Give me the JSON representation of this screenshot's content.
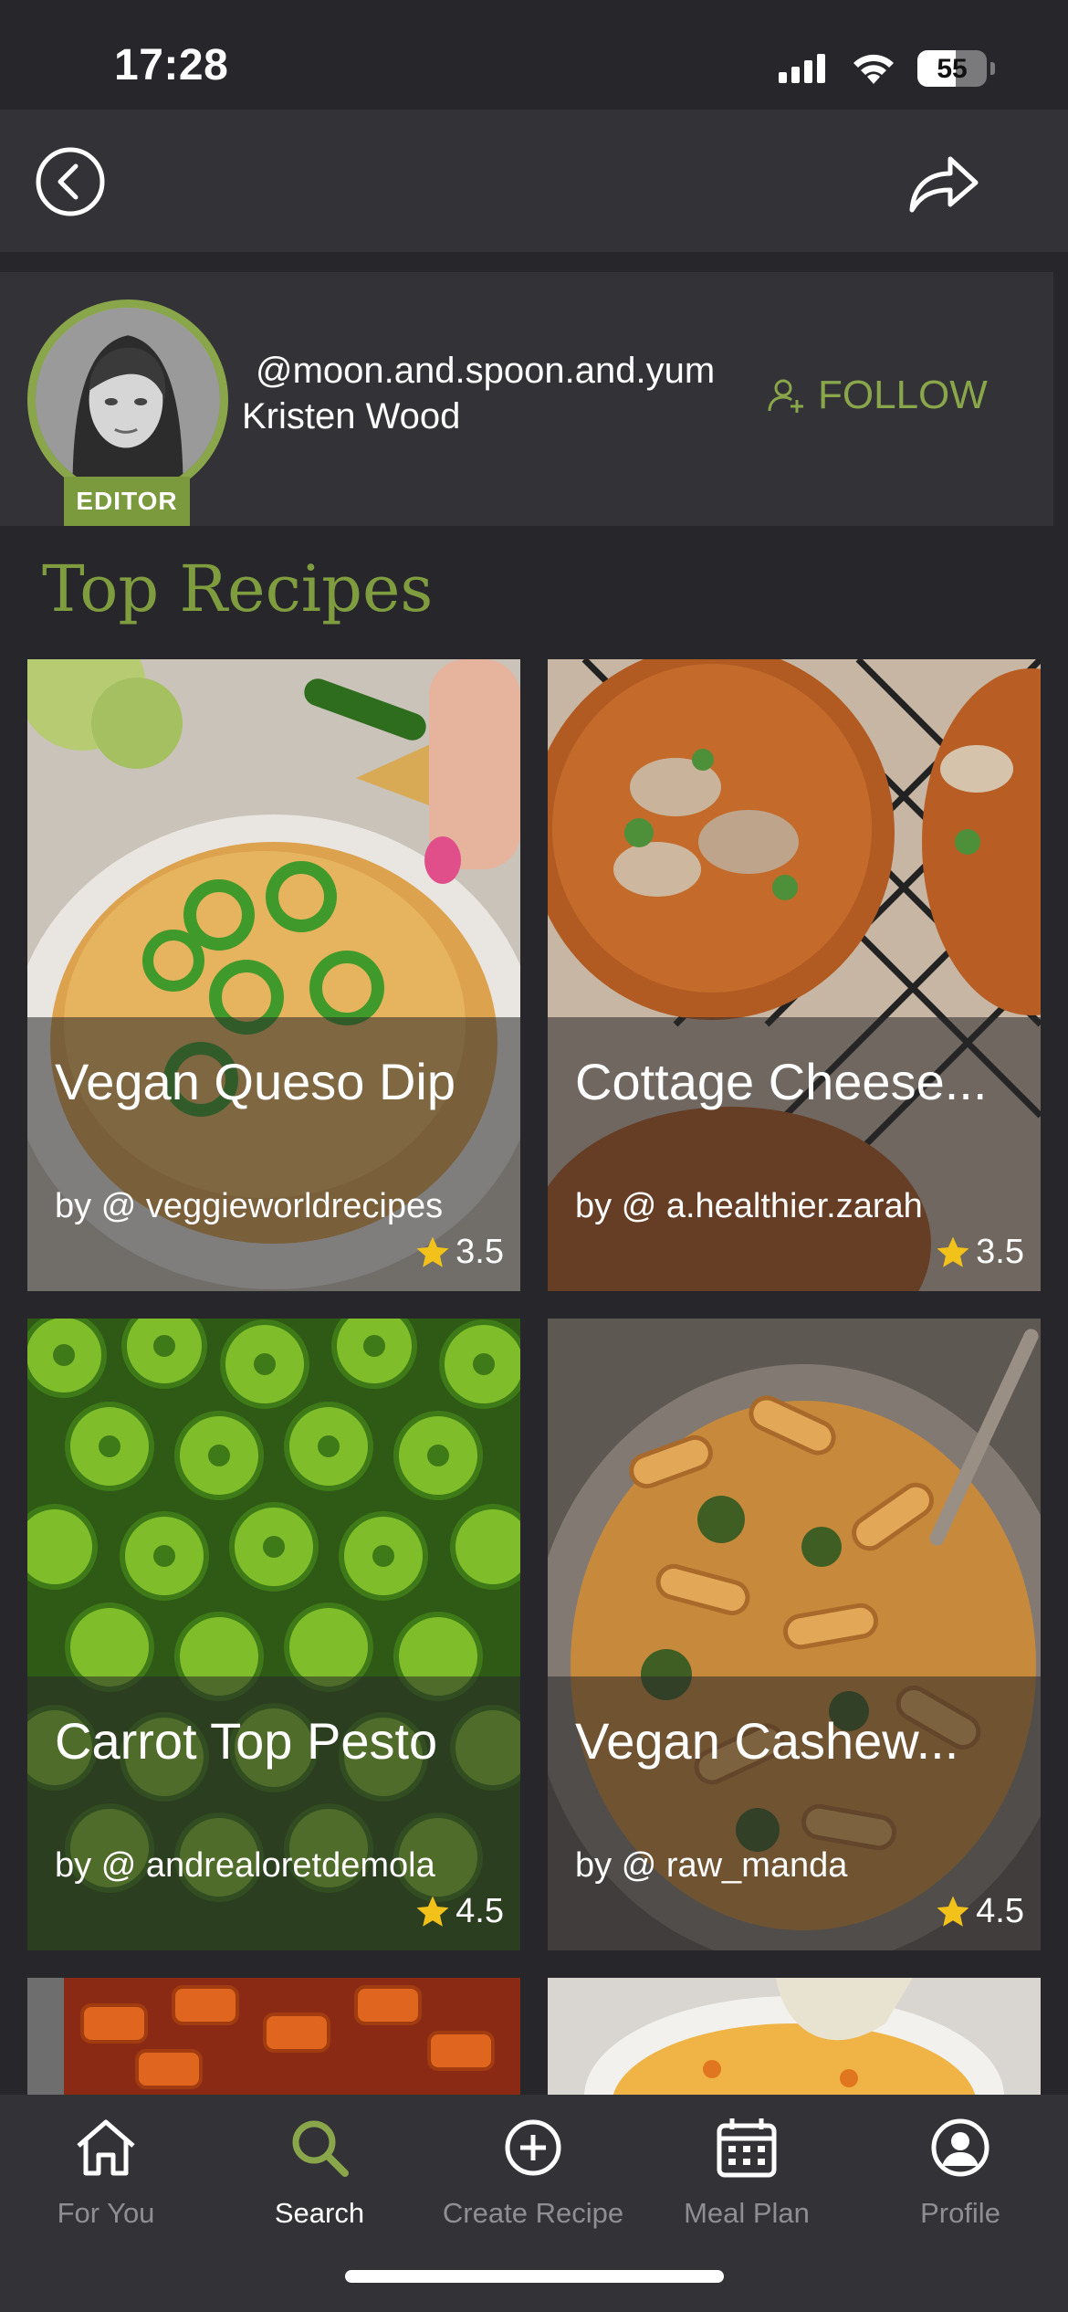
{
  "status_bar": {
    "time": "17:28",
    "battery": "55",
    "battery_level": 0.55,
    "icons": [
      "cellular-signal-icon",
      "wifi-icon",
      "battery-icon"
    ]
  },
  "nav": {
    "back_icon": "chevron-left-circle-icon",
    "share_icon": "share-arrow-icon"
  },
  "profile": {
    "handle": "@moon.and.spoon.and.yum",
    "name": "Kristen Wood",
    "badge": "EDITOR",
    "follow_label": "FOLLOW",
    "follow_icon": "add-person-icon"
  },
  "section": {
    "title": "Top Recipes"
  },
  "recipes": [
    {
      "title": "Vegan Queso Dip",
      "author": "by @ veggieworldrecipes",
      "rating": "3.5"
    },
    {
      "title": "Cottage Cheese...",
      "author": "by @ a.healthier.zarah",
      "rating": "3.5"
    },
    {
      "title": "Carrot Top Pesto",
      "author": "by @ andrealoretdemola",
      "rating": "4.5"
    },
    {
      "title": "Vegan Cashew...",
      "author": "by @ raw_manda",
      "rating": "4.5"
    }
  ],
  "tabs": [
    {
      "label": "For You",
      "icon": "home-icon",
      "active": false
    },
    {
      "label": "Search",
      "icon": "search-icon",
      "active": true
    },
    {
      "label": "Create Recipe",
      "icon": "plus-circle-icon",
      "active": false
    },
    {
      "label": "Meal Plan",
      "icon": "calendar-icon",
      "active": false
    },
    {
      "label": "Profile",
      "icon": "profile-icon",
      "active": false
    }
  ],
  "colors": {
    "background": "#27262b",
    "surface": "#333237",
    "accent": "#8aa64a",
    "star": "#f2c21b"
  }
}
